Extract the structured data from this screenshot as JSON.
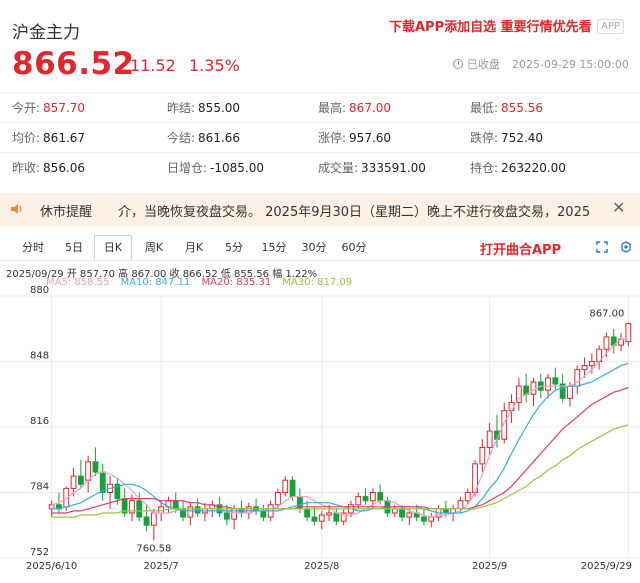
{
  "header": {
    "title": "沪金主力",
    "promo": "下载APP添加自选 重要行情优先看",
    "app_badge": "APP",
    "price": "866.52",
    "change": "11.52",
    "change_pct": "1.35%",
    "status": "已收盘",
    "status_time": "2025-09-29 15:00:00"
  },
  "stats": [
    [
      {
        "label": "今开:",
        "value": "857.70",
        "color": "red"
      },
      {
        "label": "昨结:",
        "value": "855.00",
        "color": "dark"
      },
      {
        "label": "最高:",
        "value": "867.00",
        "color": "red"
      },
      {
        "label": "最低:",
        "value": "855.56",
        "color": "red"
      }
    ],
    [
      {
        "label": "均价:",
        "value": "861.67",
        "color": "dark"
      },
      {
        "label": "今结:",
        "value": "861.66",
        "color": "dark"
      },
      {
        "label": "涨停:",
        "value": "957.60",
        "color": "dark"
      },
      {
        "label": "跌停:",
        "value": "752.40",
        "color": "dark"
      }
    ],
    [
      {
        "label": "昨收:",
        "value": "856.06",
        "color": "dark"
      },
      {
        "label": "日增仓:",
        "value": "-1085.00",
        "color": "dark"
      },
      {
        "label": "成交量:",
        "value": "333591.00",
        "color": "dark"
      },
      {
        "label": "持仓:",
        "value": "263220.00",
        "color": "dark"
      }
    ]
  ],
  "notice": {
    "title": "休市提醒",
    "text": "介，当晚恢复夜盘交易。   2025年9月30日（星期二）晚上不进行夜盘交易，2025",
    "close": "✕"
  },
  "tabs": [
    "分时",
    "5日",
    "日K",
    "周K",
    "月K",
    "5分",
    "15分",
    "30分",
    "60分"
  ],
  "active_tab": "日K",
  "open_app": "打开曲合APP",
  "info_line": "2025/09/29  开 857.70  高 867.00  收 866.52  低 855.56  幅 1.22%",
  "ma_legend": [
    {
      "label": "MA5: 858.55",
      "color": "#f0a0c0"
    },
    {
      "label": "MA10: 847.11",
      "color": "#30b0e0"
    },
    {
      "label": "MA20: 835.31",
      "color": "#e8386a"
    },
    {
      "label": "MA30: 817.09",
      "color": "#9cc43c"
    }
  ],
  "chart_data": {
    "type": "candlestick",
    "yaxis_ticks": [
      "880",
      "848",
      "816",
      "784",
      "752"
    ],
    "ylim": [
      752,
      880
    ],
    "xaxis_ticks": [
      "2025/6/10",
      "2025/7",
      "2025/8",
      "2025/9",
      "2025/9/29"
    ],
    "annotations": {
      "high_label": "867.00",
      "low_label": "760.58"
    },
    "candles": [
      [
        776,
        780,
        772,
        778
      ],
      [
        778,
        784,
        774,
        776
      ],
      [
        777,
        787,
        775,
        786
      ],
      [
        786,
        796,
        782,
        792
      ],
      [
        792,
        800,
        786,
        788
      ],
      [
        790,
        802,
        784,
        799
      ],
      [
        799,
        806,
        792,
        794
      ],
      [
        794,
        798,
        780,
        784
      ],
      [
        784,
        792,
        776,
        788
      ],
      [
        788,
        791,
        778,
        781
      ],
      [
        781,
        786,
        772,
        774
      ],
      [
        774,
        783,
        770,
        780
      ],
      [
        780,
        784,
        770,
        772
      ],
      [
        772,
        778,
        765,
        768
      ],
      [
        768,
        776,
        760.58,
        774
      ],
      [
        774,
        780,
        770,
        777
      ],
      [
        777,
        782,
        774,
        780
      ],
      [
        780,
        784,
        774,
        776
      ],
      [
        776,
        780,
        770,
        772
      ],
      [
        772,
        779,
        768,
        777
      ],
      [
        777,
        781,
        772,
        774
      ],
      [
        774,
        779,
        770,
        776
      ],
      [
        776,
        780,
        772,
        778
      ],
      [
        778,
        782,
        772,
        774
      ],
      [
        774,
        778,
        768,
        771
      ],
      [
        771,
        778,
        766,
        776
      ],
      [
        776,
        780,
        772,
        774
      ],
      [
        774,
        779,
        771,
        777
      ],
      [
        777,
        781,
        773,
        775
      ],
      [
        775,
        778,
        770,
        772
      ],
      [
        772,
        780,
        770,
        778
      ],
      [
        778,
        786,
        776,
        784
      ],
      [
        784,
        792,
        782,
        790
      ],
      [
        790,
        792,
        780,
        782
      ],
      [
        782,
        786,
        774,
        776
      ],
      [
        776,
        780,
        770,
        772
      ],
      [
        772,
        777,
        768,
        770
      ],
      [
        770,
        775,
        766,
        773
      ],
      [
        773,
        778,
        770,
        774
      ],
      [
        774,
        776,
        768,
        770
      ],
      [
        770,
        776,
        768,
        774
      ],
      [
        774,
        780,
        772,
        778
      ],
      [
        778,
        784,
        776,
        782
      ],
      [
        782,
        786,
        778,
        780
      ],
      [
        780,
        786,
        776,
        784
      ],
      [
        784,
        788,
        778,
        780
      ],
      [
        780,
        782,
        772,
        774
      ],
      [
        774,
        778,
        772,
        776
      ],
      [
        776,
        778,
        770,
        772
      ],
      [
        772,
        776,
        768,
        774
      ],
      [
        774,
        778,
        770,
        772
      ],
      [
        772,
        776,
        768,
        770
      ],
      [
        770,
        774,
        767,
        772
      ],
      [
        772,
        778,
        770,
        776
      ],
      [
        776,
        780,
        772,
        774
      ],
      [
        774,
        778,
        770,
        776
      ],
      [
        776,
        782,
        774,
        780
      ],
      [
        780,
        786,
        778,
        784
      ],
      [
        784,
        800,
        782,
        798
      ],
      [
        798,
        810,
        794,
        806
      ],
      [
        806,
        818,
        802,
        814
      ],
      [
        814,
        822,
        806,
        810
      ],
      [
        810,
        828,
        808,
        824
      ],
      [
        824,
        832,
        818,
        828
      ],
      [
        828,
        840,
        824,
        836
      ],
      [
        836,
        842,
        828,
        832
      ],
      [
        832,
        840,
        826,
        838
      ],
      [
        838,
        842,
        830,
        834
      ],
      [
        834,
        842,
        830,
        840
      ],
      [
        840,
        845,
        834,
        837
      ],
      [
        837,
        842,
        828,
        830
      ],
      [
        830,
        838,
        826,
        836
      ],
      [
        836,
        846,
        832,
        844
      ],
      [
        844,
        850,
        840,
        846
      ],
      [
        846,
        852,
        842,
        848
      ],
      [
        848,
        856,
        844,
        854
      ],
      [
        854,
        862,
        850,
        860
      ],
      [
        860,
        864,
        852,
        856
      ],
      [
        856,
        862,
        853,
        859
      ],
      [
        857.7,
        867,
        855.56,
        866.52
      ]
    ],
    "ma_series": [
      {
        "name": "MA5",
        "color": "#f0a0c0",
        "values": [
          778,
          779,
          781,
          784,
          786,
          790,
          793,
          794,
          793,
          791,
          788,
          785,
          781,
          778,
          774,
          774,
          774,
          775,
          776,
          776,
          776,
          776,
          776,
          776,
          775,
          774,
          774,
          774,
          775,
          775,
          776,
          777,
          780,
          782,
          782,
          782,
          780,
          778,
          777,
          774,
          773,
          773,
          774,
          776,
          778,
          780,
          780,
          779,
          777,
          775,
          774,
          773,
          772,
          773,
          773,
          774,
          775,
          778,
          784,
          793,
          802,
          810,
          818,
          824,
          830,
          832,
          834,
          836,
          836,
          836,
          836,
          836,
          838,
          841,
          844,
          848,
          852,
          856,
          859,
          858.55
        ]
      },
      {
        "name": "MA10",
        "color": "#30b0e0",
        "values": [
          776,
          776,
          777,
          778,
          779,
          781,
          783,
          785,
          786,
          787,
          788,
          788,
          787,
          785,
          782,
          779,
          777,
          776,
          775,
          775,
          775,
          775,
          775,
          775,
          775,
          775,
          775,
          775,
          775,
          775,
          775,
          775,
          776,
          777,
          778,
          779,
          779,
          779,
          779,
          778,
          777,
          776,
          775,
          775,
          776,
          776,
          777,
          777,
          777,
          777,
          777,
          776,
          775,
          774,
          774,
          774,
          774,
          775,
          777,
          781,
          786,
          790,
          796,
          803,
          810,
          816,
          822,
          827,
          831,
          834,
          835,
          836,
          836,
          837,
          838,
          840,
          842,
          844,
          846,
          847.11
        ]
      },
      {
        "name": "MA20",
        "color": "#e8386a",
        "values": [
          774,
          774,
          774,
          775,
          775,
          776,
          777,
          778,
          779,
          780,
          781,
          781,
          781,
          781,
          781,
          780,
          780,
          780,
          780,
          779,
          779,
          778,
          778,
          777,
          777,
          776,
          776,
          776,
          776,
          776,
          776,
          776,
          776,
          776,
          777,
          777,
          777,
          777,
          777,
          777,
          777,
          777,
          777,
          777,
          777,
          777,
          777,
          777,
          777,
          777,
          777,
          777,
          776,
          776,
          776,
          776,
          776,
          776,
          777,
          778,
          780,
          782,
          784,
          787,
          791,
          795,
          799,
          803,
          807,
          811,
          815,
          818,
          821,
          824,
          827,
          829,
          831,
          833,
          834,
          835.31
        ]
      },
      {
        "name": "MA30",
        "color": "#9cc43c",
        "values": [
          772,
          772,
          772,
          772,
          773,
          773,
          773,
          774,
          774,
          774,
          775,
          775,
          775,
          775,
          775,
          775,
          776,
          776,
          776,
          776,
          776,
          776,
          776,
          776,
          776,
          776,
          776,
          776,
          776,
          776,
          776,
          776,
          776,
          776,
          776,
          776,
          776,
          776,
          776,
          776,
          776,
          776,
          776,
          776,
          776,
          776,
          776,
          776,
          776,
          776,
          776,
          776,
          776,
          776,
          776,
          776,
          776,
          776,
          776,
          777,
          778,
          779,
          781,
          783,
          785,
          787,
          790,
          792,
          795,
          797,
          800,
          802,
          805,
          807,
          809,
          811,
          813,
          815,
          816,
          817.09
        ]
      }
    ]
  }
}
